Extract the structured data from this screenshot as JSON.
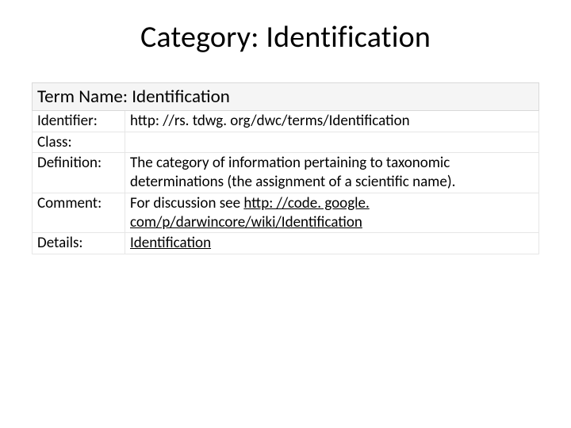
{
  "title": "Category: Identification",
  "term_header": "Term Name: Identification",
  "rows": {
    "identifier_label": "Identifier:",
    "identifier_value": "http: //rs. tdwg. org/dwc/terms/Identification",
    "class_label": "Class:",
    "class_value": "",
    "definition_label": "Definition:",
    "definition_value": "The category of information pertaining to taxonomic determinations (the assignment of a scientific name).",
    "comment_label": "Comment:",
    "comment_prefix": "For discussion see ",
    "comment_link": "http: //code. google. com/p/darwincore/wiki/Identification",
    "details_label": "Details:",
    "details_link": "Identification"
  }
}
